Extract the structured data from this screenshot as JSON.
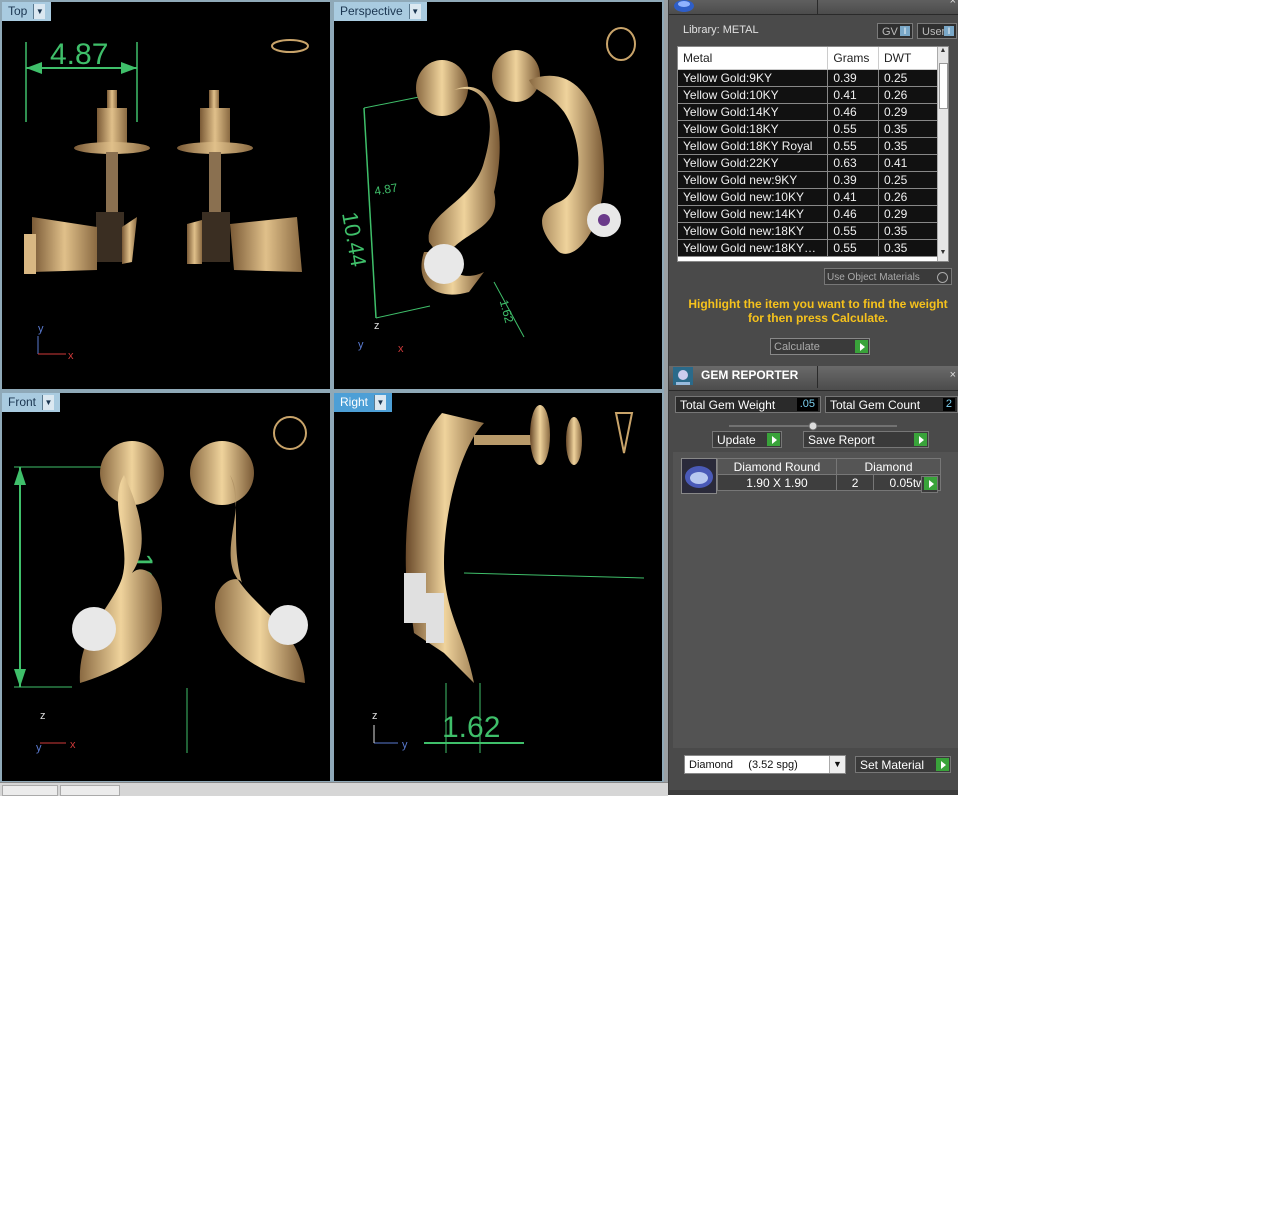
{
  "viewports": {
    "top": {
      "label": "Top",
      "dimension": "4.87"
    },
    "perspective": {
      "label": "Perspective",
      "dims": [
        "4.87",
        "10.44",
        "1.62"
      ]
    },
    "front": {
      "label": "Front",
      "dimension": "10.44"
    },
    "right": {
      "label": "Right",
      "dimension": "1.62"
    }
  },
  "axis_labels": {
    "x": "x",
    "y": "y",
    "z": "z"
  },
  "metal_panel": {
    "library_label": "Library: METAL",
    "gv_label": "GV",
    "user_label": "User",
    "indicator": "I",
    "columns": [
      "Metal",
      "Grams",
      "DWT"
    ],
    "rows": [
      [
        "Yellow Gold:9KY",
        "0.39",
        "0.25"
      ],
      [
        "Yellow Gold:10KY",
        "0.41",
        "0.26"
      ],
      [
        "Yellow Gold:14KY",
        "0.46",
        "0.29"
      ],
      [
        "Yellow Gold:18KY",
        "0.55",
        "0.35"
      ],
      [
        "Yellow Gold:18KY Royal",
        "0.55",
        "0.35"
      ],
      [
        "Yellow Gold:22KY",
        "0.63",
        "0.41"
      ],
      [
        "Yellow Gold new:9KY",
        "0.39",
        "0.25"
      ],
      [
        "Yellow Gold new:10KY",
        "0.41",
        "0.26"
      ],
      [
        "Yellow Gold new:14KY",
        "0.46",
        "0.29"
      ],
      [
        "Yellow Gold new:18KY",
        "0.55",
        "0.35"
      ],
      [
        "Yellow Gold new:18KY…",
        "0.55",
        "0.35"
      ]
    ],
    "use_object_materials": "Use Object Materials",
    "hint": "Highlight the item you want to find the weight for then press Calculate.",
    "calculate_label": "Calculate"
  },
  "gem_reporter": {
    "title": "GEM REPORTER",
    "total_weight_label": "Total Gem Weight",
    "total_weight_value": ".05",
    "total_count_label": "Total Gem Count",
    "total_count_value": "2",
    "update_label": "Update",
    "save_report_label": "Save Report",
    "gem": {
      "shape": "Diamond Round",
      "material": "Diamond",
      "size": "1.90 X 1.90",
      "count": "2",
      "weight": "0.05tw"
    },
    "material_select": "Diamond     (3.52 spg)",
    "set_material_label": "Set Material"
  },
  "colors": {
    "accent": "#4d9fd6",
    "gold": "#c9a46a",
    "dimension_green": "#3fbf6a",
    "hint": "#f6c21c",
    "go_green": "#39a33a"
  }
}
